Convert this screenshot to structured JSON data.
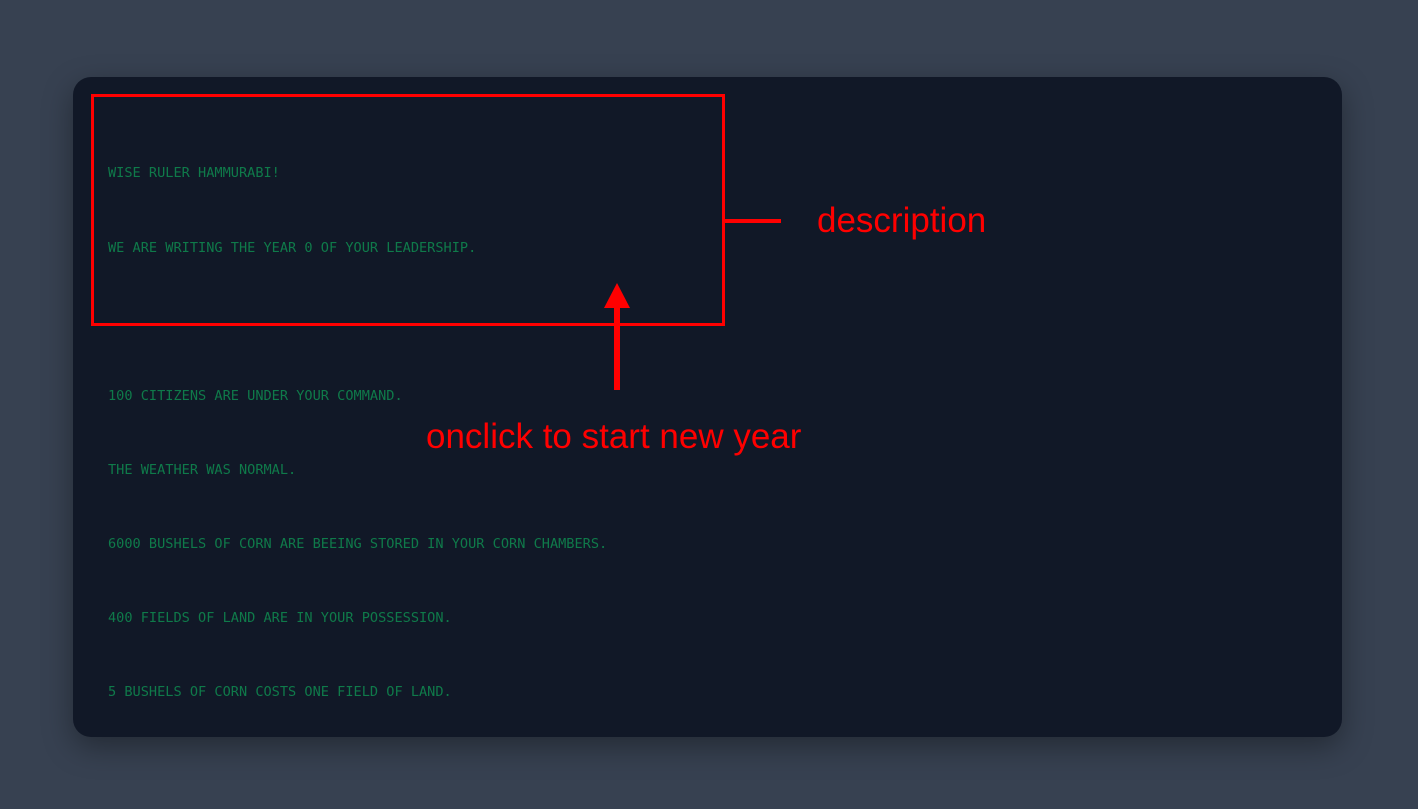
{
  "terminal": {
    "lines": [
      "WISE RULER HAMMURABI!",
      "WE ARE WRITING THE YEAR 0 OF YOUR LEADERSHIP.",
      "",
      "100 CITIZENS ARE UNDER YOUR COMMAND.",
      "THE WEATHER WAS NORMAL.",
      "6000 BUSHELS OF CORN ARE BEEING STORED IN YOUR CORN CHAMBERS.",
      "400 FIELDS OF LAND ARE IN YOUR POSSESSION.",
      "5 BUSHELS OF CORN COSTS ONE FIELD OF LAND."
    ],
    "text_color": "#0f7a4a",
    "background": "#111827"
  },
  "annotations": {
    "description_label": "description",
    "onclick_label": "onclick to start new year",
    "color": "#ff0000"
  },
  "page": {
    "background": "#374151"
  }
}
